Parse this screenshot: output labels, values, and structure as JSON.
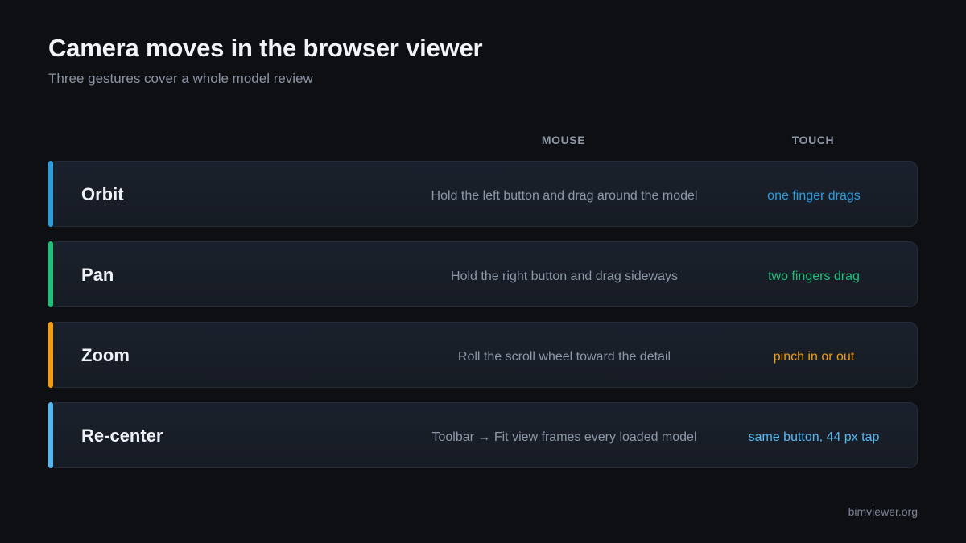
{
  "header": {
    "title": "Camera moves in the browser viewer",
    "subtitle": "Three gestures cover a whole model review"
  },
  "columns": {
    "mouse": "MOUSE",
    "touch": "TOUCH"
  },
  "rows": [
    {
      "name": "Orbit",
      "mouse": "Hold the left button and drag around the model",
      "touch": "one finger drags",
      "color": "#2d9cdb"
    },
    {
      "name": "Pan",
      "mouse": "Hold the right button and drag sideways",
      "touch": "two fingers drag",
      "color": "#1fbf7a"
    },
    {
      "name": "Zoom",
      "mouse": "Roll the scroll wheel toward the detail",
      "touch": "pinch in or out",
      "color": "#f39c12"
    },
    {
      "name": "Re-center",
      "mouse": "Toolbar → Fit view frames every loaded model",
      "touch": "same button, 44 px tap",
      "color": "#56b8f0"
    }
  ],
  "footer": "bimviewer.org"
}
